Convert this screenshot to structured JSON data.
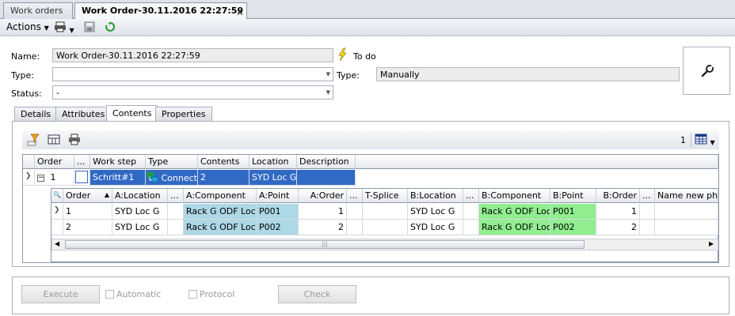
{
  "tabs": [
    {
      "label": "Work orders",
      "active": false
    },
    {
      "label": "Work Order-30.11.2016 22:27:59",
      "active": true
    }
  ],
  "toolbar": {
    "actions_label": "Actions",
    "print_icon": "printer-icon",
    "save_icon": "save-icon",
    "refresh_icon": "refresh-icon"
  },
  "form": {
    "name_label": "Name:",
    "name_value": "Work Order-30.11.2016 22:27:59",
    "state_text": "To do",
    "type_label": "Type:",
    "type_value": "",
    "type2_label": "Type:",
    "type2_value": "Manually",
    "status_label": "Status:",
    "status_value": "-"
  },
  "inner_tabs": [
    {
      "label": "Details",
      "active": false
    },
    {
      "label": "Attributes",
      "active": false
    },
    {
      "label": "Contents",
      "active": true
    },
    {
      "label": "Properties",
      "active": false
    }
  ],
  "grid_toolbar": {
    "count": "1"
  },
  "master_grid": {
    "columns": [
      "Order",
      "...",
      "Work step",
      "Type",
      "Contents",
      "Location",
      "Description"
    ],
    "row": {
      "order": "1",
      "work_step": "Schritt#1",
      "type": "Connect",
      "contents": "2",
      "location": "SYD Loc G",
      "description": ""
    }
  },
  "detail_grid": {
    "columns": [
      "Order",
      "A:Location",
      "...",
      "A:Component",
      "A:Point",
      "A:Order",
      "...",
      "T-Splice",
      "B:Location",
      "...",
      "B:Component",
      "B:Point",
      "B:Order",
      "...",
      "Name new phys"
    ],
    "rows": [
      {
        "order": "1",
        "a_location": "SYD Loc G",
        "a_component": "Rack G ODF LocH",
        "a_point": "P001",
        "a_order": "1",
        "t_splice": "",
        "b_location": "SYD Loc G",
        "b_component": "Rack G ODF LocF",
        "b_point": "P001",
        "b_order": "1",
        "name_new": ""
      },
      {
        "order": "2",
        "a_location": "SYD Loc G",
        "a_component": "Rack G ODF LocH",
        "a_point": "P002",
        "a_order": "2",
        "t_splice": "",
        "b_location": "SYD Loc G",
        "b_component": "Rack G ODF LocF",
        "b_point": "P002",
        "b_order": "2",
        "name_new": ""
      }
    ]
  },
  "bottom": {
    "execute_label": "Execute",
    "automatic_label": "Automatic",
    "protocol_label": "Protocol",
    "check_label": "Check"
  },
  "colors": {
    "selection": "#316ac5",
    "a_side": "#add8e6",
    "b_side": "#90ee90"
  }
}
